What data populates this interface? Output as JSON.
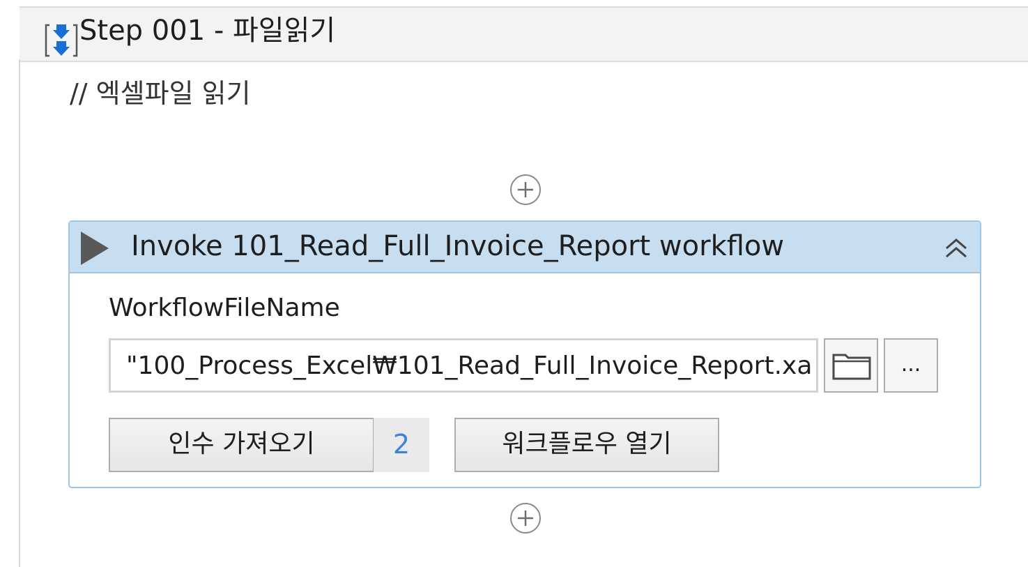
{
  "sequence": {
    "title": "Step 001 - 파일읽기",
    "icon": "sequence-icon",
    "comment": "// 엑셀파일 읽기"
  },
  "activity": {
    "title": "Invoke 101_Read_Full_Invoice_Report workflow",
    "icon": "play-icon",
    "collapse_icon": "double-chevron-up-icon",
    "header_color": "#c7ddf0",
    "border_color": "#9ec5e3",
    "field_label": "WorkflowFileName",
    "field_value": "\"100_Process_Excel₩101_Read_Full_Invoice_Report.xa",
    "browse_icon": "folder-icon",
    "more_label": "...",
    "import_args_label": "인수 가져오기",
    "args_count": "2",
    "open_workflow_label": "워크플로우 열기"
  },
  "add_icon": "add-activity-icon"
}
